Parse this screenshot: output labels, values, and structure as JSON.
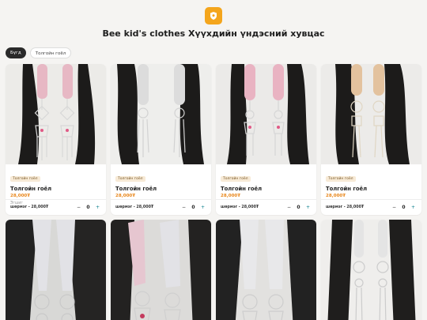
{
  "header": {
    "logo_icon": "shop-badge-icon",
    "title": "Bee kid's clothes Хүүхдийн үндэсний хувцас"
  },
  "filters": [
    {
      "label": "Бүгд",
      "active": true
    },
    {
      "label": "Толгойн гоёл",
      "active": false
    }
  ],
  "products": [
    {
      "tag": "Толгойн гоёл",
      "name": "Толгойн гоёл",
      "price": "28,000₮",
      "note": "Эгшиг",
      "variant": "шөрмэг - 28,000₮",
      "qty": "0",
      "minus": "−",
      "plus": "+",
      "bead_color": "#e7b8c4"
    },
    {
      "tag": "Толгойн гоёл",
      "name": "Толгойн гоёл",
      "price": "28,000₮",
      "note": "",
      "variant": "шөрмэг - 28,000₮",
      "qty": "0",
      "minus": "−",
      "plus": "+",
      "bead_color": "#dcdcdc"
    },
    {
      "tag": "Толгойн гоёл",
      "name": "Толгойн гоёл",
      "price": "28,000₮",
      "note": "",
      "variant": "шөрмэг - 28,000₮",
      "qty": "0",
      "minus": "−",
      "plus": "+",
      "bead_color": "#e9b3c2"
    },
    {
      "tag": "Толгойн гоёл",
      "name": "Толгойн гоёл",
      "price": "28,000₮",
      "note": "",
      "variant": "шөрмэг - 28,000₮",
      "qty": "0",
      "minus": "−",
      "plus": "+",
      "bead_color": "#e3c29e"
    }
  ],
  "products_row2": [
    {
      "bead_color": "#e2e2e6"
    },
    {
      "bead_color": "#e6c6d0"
    },
    {
      "bead_color": "#e8e8ea"
    },
    {
      "bead_color": "#e4e4e4"
    }
  ]
}
